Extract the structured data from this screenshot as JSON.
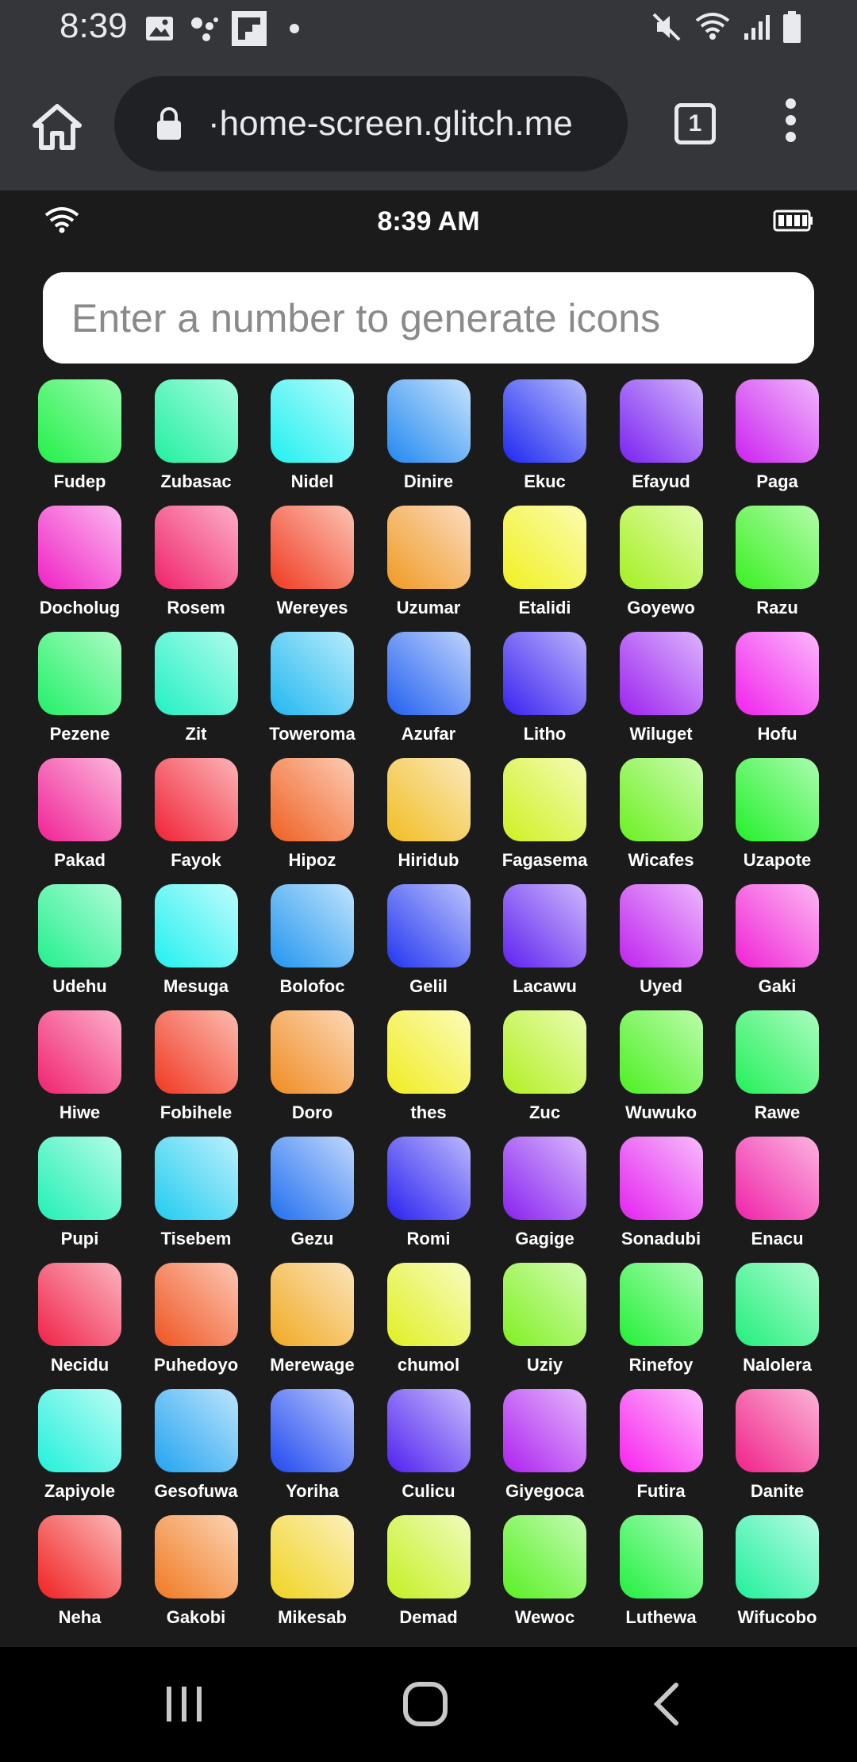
{
  "status_bar": {
    "time": "8:39",
    "icons": [
      "gallery-icon",
      "assistant-icon",
      "flipboard-icon",
      "dot-icon",
      "mute-icon",
      "wifi-icon",
      "signal-icon",
      "battery-icon"
    ]
  },
  "browser": {
    "url": "·home-screen.glitch.me",
    "tab_count": "1"
  },
  "app_status": {
    "time": "8:39 AM"
  },
  "search": {
    "placeholder": "Enter a number to generate icons"
  },
  "apps": [
    {
      "name": "Fudep",
      "colors": [
        "#22f04a",
        "#9cfcb0"
      ]
    },
    {
      "name": "Zubasac",
      "colors": [
        "#22f0a0",
        "#a8fce0"
      ]
    },
    {
      "name": "Nidel",
      "colors": [
        "#22f0ef",
        "#b8fcfc"
      ]
    },
    {
      "name": "Dinire",
      "colors": [
        "#2288f0",
        "#c8e4fc"
      ]
    },
    {
      "name": "Ekuc",
      "colors": [
        "#1e28f0",
        "#b4bcfc"
      ]
    },
    {
      "name": "Efayud",
      "colors": [
        "#7a22f0",
        "#d2b6fc"
      ]
    },
    {
      "name": "Paga",
      "colors": [
        "#cc22f0",
        "#f0b8fc"
      ]
    },
    {
      "name": "Docholug",
      "colors": [
        "#f022c4",
        "#fcb8f0"
      ]
    },
    {
      "name": "Rosem",
      "colors": [
        "#f0226a",
        "#fcb0c8"
      ]
    },
    {
      "name": "Wereyes",
      "colors": [
        "#f03a22",
        "#fcc4b4"
      ]
    },
    {
      "name": "Uzumar",
      "colors": [
        "#f09a22",
        "#fcdcc0"
      ]
    },
    {
      "name": "Etalidi",
      "colors": [
        "#f0f022",
        "#fcfcb0"
      ]
    },
    {
      "name": "Goyewo",
      "colors": [
        "#a4f022",
        "#e4fcb0"
      ]
    },
    {
      "name": "Razu",
      "colors": [
        "#3af022",
        "#b4fcac"
      ]
    },
    {
      "name": "Pezene",
      "colors": [
        "#22f068",
        "#acfcc4"
      ]
    },
    {
      "name": "Zit",
      "colors": [
        "#22f0c4",
        "#b0fcec"
      ]
    },
    {
      "name": "Toweroma",
      "colors": [
        "#22b8f0",
        "#b8ecfc"
      ]
    },
    {
      "name": "Azufar",
      "colors": [
        "#2260f0",
        "#c0d4fc"
      ]
    },
    {
      "name": "Litho",
      "colors": [
        "#3a22f0",
        "#bcb4fc"
      ]
    },
    {
      "name": "Wiluget",
      "colors": [
        "#9c22f0",
        "#dcb4fc"
      ]
    },
    {
      "name": "Hofu",
      "colors": [
        "#f022ec",
        "#fcb8fc"
      ]
    },
    {
      "name": "Pakad",
      "colors": [
        "#f02296",
        "#fcb8dc"
      ]
    },
    {
      "name": "Fayok",
      "colors": [
        "#f02234",
        "#fcb4b8"
      ]
    },
    {
      "name": "Hipoz",
      "colors": [
        "#f06022",
        "#fcccb4"
      ]
    },
    {
      "name": "Hiridub",
      "colors": [
        "#f0be22",
        "#fce8bc"
      ]
    },
    {
      "name": "Fagasema",
      "colors": [
        "#d0f022",
        "#f4fcb4"
      ]
    },
    {
      "name": "Wicafes",
      "colors": [
        "#6cf022",
        "#ccfcb0"
      ]
    },
    {
      "name": "Uzapote",
      "colors": [
        "#22f02a",
        "#acfcb0"
      ]
    },
    {
      "name": "Udehu",
      "colors": [
        "#22f08c",
        "#b0fcd8"
      ]
    },
    {
      "name": "Mesuga",
      "colors": [
        "#22f0f0",
        "#c0fcfc"
      ]
    },
    {
      "name": "Bolofoc",
      "colors": [
        "#2296f0",
        "#c0e4fc"
      ]
    },
    {
      "name": "Gelil",
      "colors": [
        "#2236f0",
        "#bcc4fc"
      ]
    },
    {
      "name": "Lacawu",
      "colors": [
        "#6022f0",
        "#ccb8fc"
      ]
    },
    {
      "name": "Uyed",
      "colors": [
        "#c022f0",
        "#ecb8fc"
      ]
    },
    {
      "name": "Gaki",
      "colors": [
        "#f022d4",
        "#fcb8f4"
      ]
    },
    {
      "name": "Hiwe",
      "colors": [
        "#f02270",
        "#fcb0cc"
      ]
    },
    {
      "name": "Fobihele",
      "colors": [
        "#f03822",
        "#fcbcb0"
      ]
    },
    {
      "name": "Doro",
      "colors": [
        "#f08c22",
        "#fcd8b8"
      ]
    },
    {
      "name": "thes",
      "colors": [
        "#f0ec22",
        "#fcfcb8"
      ]
    },
    {
      "name": "Zuc",
      "colors": [
        "#b0f022",
        "#ecfcb4"
      ]
    },
    {
      "name": "Wuwuko",
      "colors": [
        "#4cf022",
        "#bcfcac"
      ]
    },
    {
      "name": "Rawe",
      "colors": [
        "#22f05a",
        "#acfcc0"
      ]
    },
    {
      "name": "Pupi",
      "colors": [
        "#22f0b4",
        "#b4fce8"
      ]
    },
    {
      "name": "Tisebem",
      "colors": [
        "#22ccf0",
        "#bcf0fc"
      ]
    },
    {
      "name": "Gezu",
      "colors": [
        "#2270f0",
        "#c0d8fc"
      ]
    },
    {
      "name": "Romi",
      "colors": [
        "#2a22f0",
        "#bcb8fc"
      ]
    },
    {
      "name": "Gagige",
      "colors": [
        "#8822f0",
        "#d8b8fc"
      ]
    },
    {
      "name": "Sonadubi",
      "colors": [
        "#e422f0",
        "#f8bcfc"
      ]
    },
    {
      "name": "Enacu",
      "colors": [
        "#f022a8",
        "#fcb4e0"
      ]
    },
    {
      "name": "Necidu",
      "colors": [
        "#f02248",
        "#fcb4c0"
      ]
    },
    {
      "name": "Puhedoyo",
      "colors": [
        "#f05422",
        "#fcc8b4"
      ]
    },
    {
      "name": "Merewage",
      "colors": [
        "#f0aa22",
        "#fce4bc"
      ]
    },
    {
      "name": "chumol",
      "colors": [
        "#e0f022",
        "#f8fcc0"
      ]
    },
    {
      "name": "Uziy",
      "colors": [
        "#80f022",
        "#d4fcb4"
      ]
    },
    {
      "name": "Rinefoy",
      "colors": [
        "#22f036",
        "#b0fcb8"
      ]
    },
    {
      "name": "Nalolera",
      "colors": [
        "#22f07c",
        "#b0fcd0"
      ]
    },
    {
      "name": "Zapiyole",
      "colors": [
        "#22f0dc",
        "#bcfcf4"
      ]
    },
    {
      "name": "Gesofuwa",
      "colors": [
        "#22a4f0",
        "#bce4fc"
      ]
    },
    {
      "name": "Yoriha",
      "colors": [
        "#224af0",
        "#bcc8fc"
      ]
    },
    {
      "name": "Culicu",
      "colors": [
        "#5022f0",
        "#c8bcfc"
      ]
    },
    {
      "name": "Giyegoca",
      "colors": [
        "#ae22f0",
        "#e4b8fc"
      ]
    },
    {
      "name": "Futira",
      "colors": [
        "#f822f0",
        "#fcc0fc"
      ]
    },
    {
      "name": "Danite",
      "colors": [
        "#f02288",
        "#fcb4d8"
      ]
    },
    {
      "name": "Neha",
      "colors": [
        "#f02222",
        "#fcb8b8"
      ]
    },
    {
      "name": "Gakobi",
      "colors": [
        "#f07a22",
        "#fcd4b4"
      ]
    },
    {
      "name": "Mikesab",
      "colors": [
        "#f0d422",
        "#fcf0bc"
      ]
    },
    {
      "name": "Demad",
      "colors": [
        "#c4f022",
        "#f0fcbc"
      ]
    },
    {
      "name": "Wewoc",
      "colors": [
        "#58f022",
        "#c4fcb4"
      ]
    },
    {
      "name": "Luthewa",
      "colors": [
        "#22f040",
        "#b0fcbc"
      ]
    },
    {
      "name": "Wifucobo",
      "colors": [
        "#22f09c",
        "#b8fce4"
      ]
    }
  ],
  "nav_bar": {
    "buttons": [
      "recents-icon",
      "home-icon",
      "back-icon"
    ]
  }
}
